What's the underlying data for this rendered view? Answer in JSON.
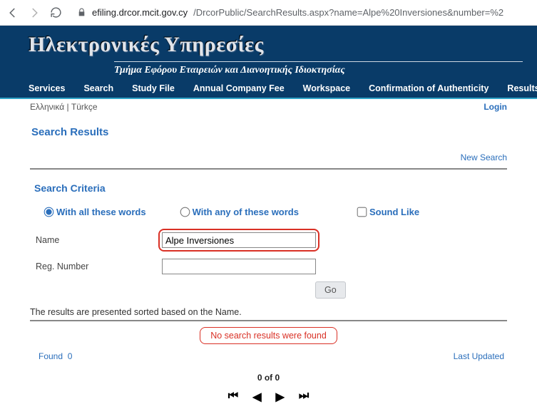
{
  "browser": {
    "url_host": "efiling.drcor.mcit.gov.cy",
    "url_path": "/DrcorPublic/SearchResults.aspx?name=Alpe%20Inversiones&number=%2"
  },
  "header": {
    "title": "Ηλεκτρονικές Υπηρεσίες",
    "subtitle": "Τμήμα Εφόρου Εταιρειών και Διανοητικής Ιδιοκτησίας"
  },
  "menu": {
    "items": [
      "Services",
      "Search",
      "Study File",
      "Annual Company Fee",
      "Workspace",
      "Confirmation of Authenticity",
      "Results of Name Exa"
    ]
  },
  "langbar": {
    "langs": "Ελληνικά | Türkçe",
    "login": "Login"
  },
  "page": {
    "title": "Search Results",
    "new_search": "New Search",
    "criteria_title": "Search Criteria",
    "radio_all": "With all these words",
    "radio_any": "With any of these words",
    "check_sound": "Sound Like",
    "label_name": "Name",
    "label_reg": "Reg. Number",
    "input_name_value": "Alpe Inversiones",
    "input_reg_value": "",
    "go": "Go",
    "sort_note": "The results are presented sorted based on the Name.",
    "no_results": "No search results were found",
    "found_label": "Found",
    "found_count": "0",
    "last_updated": "Last Updated",
    "pager_text": "0 of 0"
  }
}
